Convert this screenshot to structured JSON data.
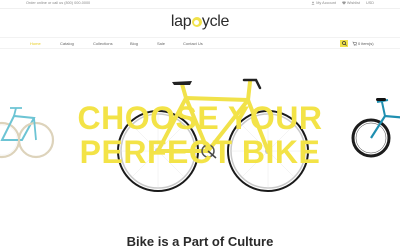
{
  "topbar": {
    "phone_text": "Order online or call us (800) 000-0000",
    "account_label": "My Account",
    "wishlist_label": "Wishlist",
    "currency_label": "USD"
  },
  "logo": {
    "part1": "lap",
    "part2": "ycle"
  },
  "nav": {
    "items": [
      {
        "label": "Home",
        "active": true
      },
      {
        "label": "Catalog"
      },
      {
        "label": "Collections"
      },
      {
        "label": "Blog"
      },
      {
        "label": "Sale"
      },
      {
        "label": "Contact Us"
      }
    ],
    "cart_label": "0 item(s)"
  },
  "hero": {
    "line1": "CHOOSE YOUR",
    "line2": "PERFECT BIKE"
  },
  "section": {
    "pre": "Bike is a ",
    "highlight": "P",
    "post": "art of Culture"
  },
  "colors": {
    "accent": "#f1e24a",
    "hero_text": "#f3e347",
    "bike_left": "#6cc4d4",
    "bike_center": "#f1e24a",
    "bike_right": "#1f8fb0"
  }
}
